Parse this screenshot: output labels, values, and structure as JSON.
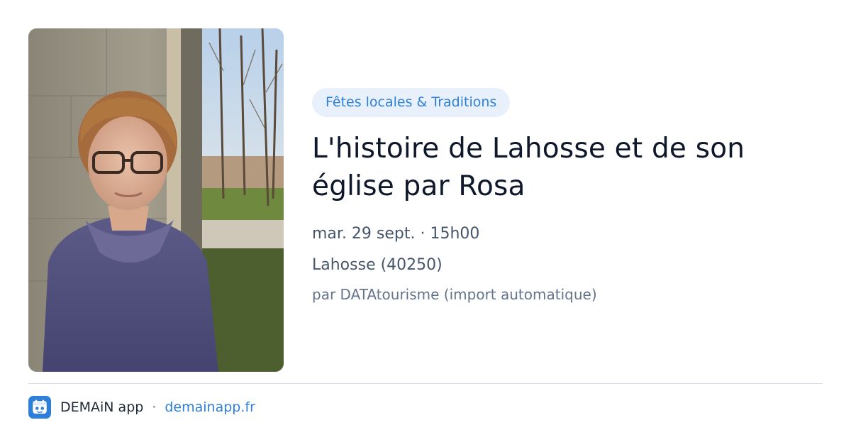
{
  "event": {
    "category": "Fêtes locales & Traditions",
    "title": "L'histoire de Lahosse et de son église par Rosa",
    "datetime": "mar. 29 sept. · 15h00",
    "location": "Lahosse (40250)",
    "source": "par DATAtourisme (import automatique)",
    "image": {
      "icon": "event-photo"
    }
  },
  "footer": {
    "app_name": "DEMAiN app",
    "separator": "·",
    "domain": "demainapp.fr",
    "icon": "demain-app-icon"
  },
  "colors": {
    "accent": "#2f7fd8",
    "tag_background": "#e8f1fb",
    "title": "#0f172a",
    "meta": "#475569",
    "divider": "#dbe3ea"
  }
}
